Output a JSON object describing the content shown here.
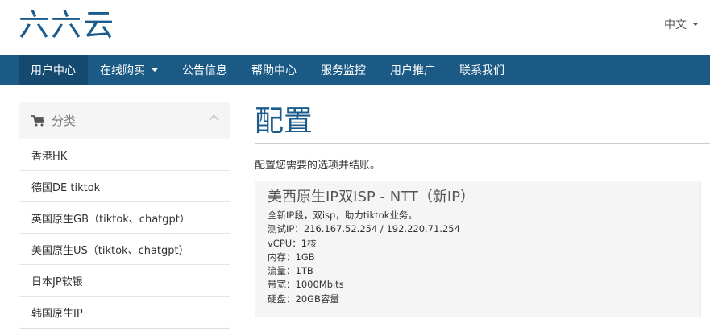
{
  "header": {
    "logo": "六六云",
    "language": "中文"
  },
  "nav": [
    {
      "label": "用户中心"
    },
    {
      "label": "在线购买"
    },
    {
      "label": "公告信息"
    },
    {
      "label": "帮助中心"
    },
    {
      "label": "服务监控"
    },
    {
      "label": "用户推广"
    },
    {
      "label": "联系我们"
    }
  ],
  "sidebar": {
    "title": "分类",
    "items": [
      {
        "label": "香港HK"
      },
      {
        "label": "德国DE tiktok"
      },
      {
        "label": "英国原生GB（tiktok、chatgpt）"
      },
      {
        "label": "美国原生US（tiktok、chatgpt）"
      },
      {
        "label": "日本JP软银"
      },
      {
        "label": "韩国原生IP"
      }
    ]
  },
  "main": {
    "title": "配置",
    "intro": "配置您需要的选项并结账。",
    "product": {
      "name": "美西原生IP双ISP - NTT（新IP）",
      "lines": [
        "全新IP段，双isp，助力tiktok业务。",
        "测试IP：216.167.52.254 / 192.220.71.254",
        "vCPU：1核",
        "内存：1GB",
        "流量：1TB",
        "带宽：1000Mbits",
        "硬盘：20GB容量"
      ]
    }
  }
}
